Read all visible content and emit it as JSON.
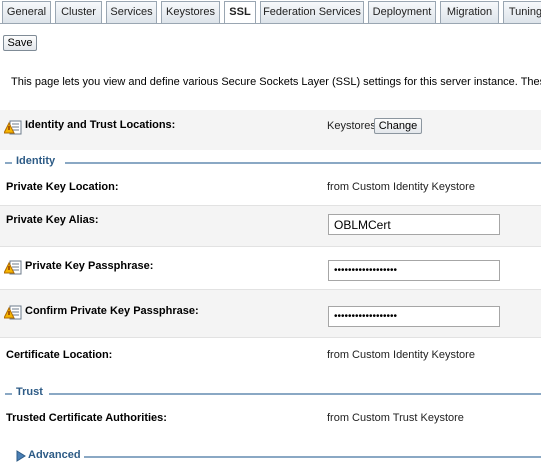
{
  "tabs": [
    "General",
    "Cluster",
    "Services",
    "Keystores",
    "SSL",
    "Federation Services",
    "Deployment",
    "Migration",
    "Tuning"
  ],
  "toolbar": {
    "save_label": "Save"
  },
  "intro_text": "This page lets you view and define various Secure Sockets Layer (SSL) settings for this server instance. These se",
  "identity_trust": {
    "label": "Identity and Trust Locations:",
    "value": "Keystores",
    "change_label": "Change"
  },
  "sections": {
    "identity": "Identity",
    "trust": "Trust",
    "advanced": "Advanced"
  },
  "identity": {
    "private_key_location": {
      "label": "Private Key Location:",
      "value": "from Custom Identity Keystore"
    },
    "private_key_alias": {
      "label": "Private Key Alias:",
      "value": "OBLMCert"
    },
    "private_key_passphrase": {
      "label": "Private Key Passphrase:",
      "value": "••••••••••••••••••"
    },
    "confirm_passphrase": {
      "label": "Confirm Private Key Passphrase:",
      "value": "••••••••••••••••••"
    },
    "certificate_location": {
      "label": "Certificate Location:",
      "value": "from Custom Identity Keystore"
    }
  },
  "trust": {
    "trusted_cas": {
      "label": "Trusted Certificate Authorities:",
      "value": "from Custom Trust Keystore"
    }
  },
  "colors": {
    "section_title": "#2d5b86",
    "section_rule": "#8aa8c4",
    "tab_border": "#9aa6b2",
    "shaded_row": "#f4f4f4"
  },
  "icons": {
    "restart_required": "warning-restart-icon",
    "advanced_toggle": "triangle-right-icon"
  }
}
